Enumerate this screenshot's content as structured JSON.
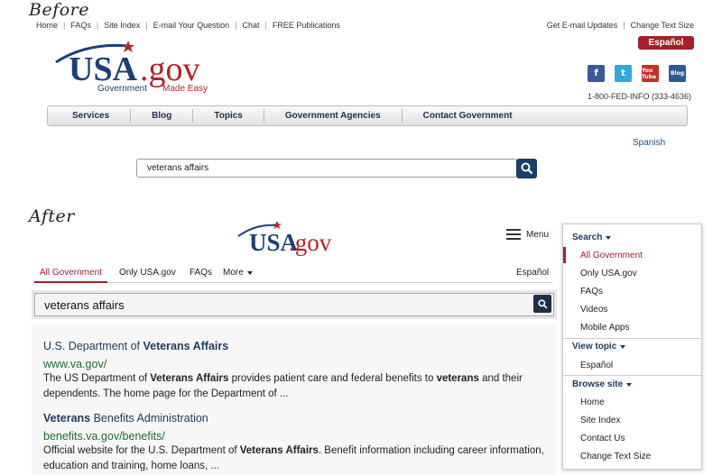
{
  "labels": {
    "before": "Before",
    "after": "After"
  },
  "before": {
    "top_links": [
      "Home",
      "FAQs",
      "Site Index",
      "E-mail Your Question",
      "Chat",
      "FREE Publications"
    ],
    "right_links": [
      "Get E-mail Updates",
      "Change Text Size"
    ],
    "espanol_button": "Español",
    "logo": {
      "text": "USA.gov",
      "tagline_1": "Government",
      "tagline_2": "Made Easy"
    },
    "social": {
      "facebook": "f",
      "twitter": "t",
      "youtube": "You Tube",
      "blog": "Blog"
    },
    "phone": "1-800-FED-INFO (333-4636)",
    "nav": [
      "Services",
      "Blog",
      "Topics",
      "Government Agencies",
      "Contact Government"
    ],
    "spanish_link": "Spanish",
    "search": {
      "value": "veterans affairs"
    }
  },
  "after": {
    "logo": {
      "text": "USA.gov"
    },
    "menu_label": "Menu",
    "tabs": [
      "All Government",
      "Only USA.gov",
      "FAQs",
      "More"
    ],
    "espanol_link": "Español",
    "search": {
      "value": "veterans affairs"
    },
    "results": [
      {
        "title_pre": "U.S. Department of ",
        "title_bold": "Veterans Affairs",
        "title_post": "",
        "url": "www.va.gov/",
        "desc": [
          {
            "t": "The US Department of ",
            "b": false
          },
          {
            "t": "Veterans Affairs",
            "b": true
          },
          {
            "t": " provides patient care and federal benefits to ",
            "b": false
          },
          {
            "t": "veterans",
            "b": true
          },
          {
            "t": " and their dependents. The home page for the Department of ...",
            "b": false
          }
        ]
      },
      {
        "title_pre": "",
        "title_bold": "Veterans",
        "title_post": " Benefits Administration",
        "url": "benefits.va.gov/benefits/",
        "desc": [
          {
            "t": "Official website for the U.S. Department of ",
            "b": false
          },
          {
            "t": "Veterans Affairs",
            "b": true
          },
          {
            "t": ". Benefit information including career information, education and training, home loans, ...",
            "b": false
          }
        ]
      }
    ],
    "dropdown": {
      "search_head": "Search",
      "search_items": [
        "All Government",
        "Only USA.gov",
        "FAQs",
        "Videos",
        "Mobile Apps"
      ],
      "view_head": "View topic",
      "view_items": [
        "Español"
      ],
      "browse_head": "Browse site",
      "browse_items": [
        "Home",
        "Site Index",
        "Contact Us",
        "Change Text Size"
      ]
    }
  },
  "colors": {
    "brand_red": "#a5202a",
    "brand_navy": "#1d3a5e",
    "url_green": "#1d6b2e"
  }
}
